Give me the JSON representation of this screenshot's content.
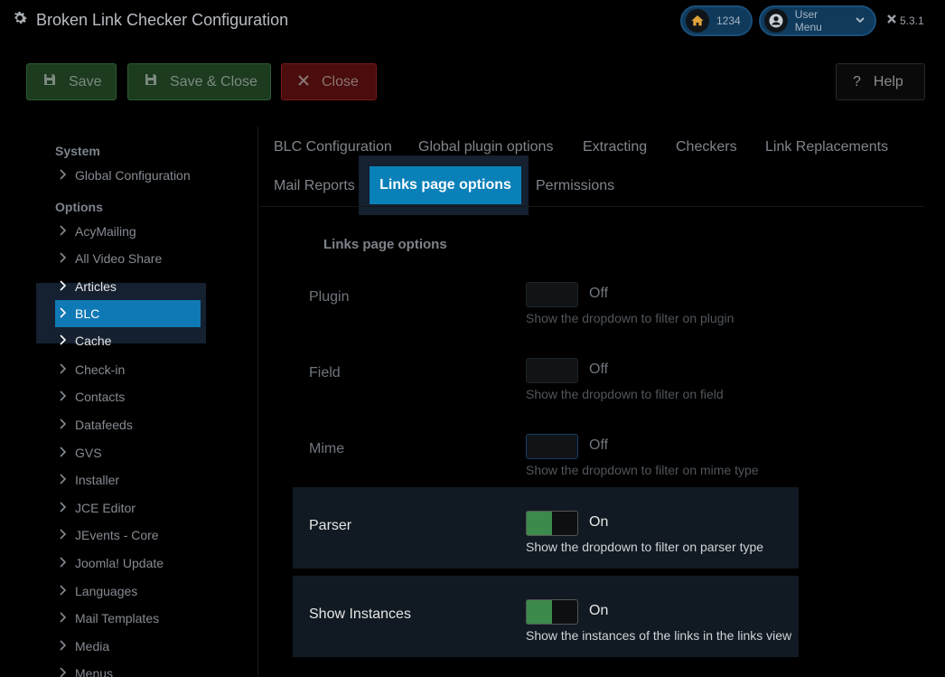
{
  "header": {
    "title": "Broken Link Checker Configuration",
    "home_count": "1234",
    "user_menu_label": "User Menu",
    "version": "5.3.1"
  },
  "toolbar": {
    "save_label": "Save",
    "save_close_label": "Save & Close",
    "close_label": "Close",
    "help_label": "Help"
  },
  "sidebar": {
    "system_heading": "System",
    "global_config": "Global Configuration",
    "options_heading": "Options",
    "items": [
      "AcyMailing",
      "All Video Share",
      "Articles",
      "BLC",
      "Cache",
      "Check-in",
      "Contacts",
      "Datafeeds",
      "GVS",
      "Installer",
      "JCE Editor",
      "JEvents - Core",
      "Joomla! Update",
      "Languages",
      "Mail Templates",
      "Media",
      "Menus"
    ],
    "active_item": "BLC"
  },
  "tabs": {
    "row1": [
      "BLC Configuration",
      "Global plugin options",
      "Extracting",
      "Checkers",
      "Link Replacements"
    ],
    "row2": [
      "Mail Reports",
      "Links page options",
      "Permissions"
    ],
    "active": "Links page options"
  },
  "section": {
    "legend": "Links page options",
    "options": [
      {
        "label": "Plugin",
        "state": "Off",
        "on": false,
        "desc": "Show the dropdown to filter on plugin"
      },
      {
        "label": "Field",
        "state": "Off",
        "on": false,
        "desc": "Show the dropdown to filter on field"
      },
      {
        "label": "Mime",
        "state": "Off",
        "on": false,
        "desc": "Show the dropdown to filter on mime type"
      },
      {
        "label": "Parser",
        "state": "On",
        "on": true,
        "desc": "Show the dropdown to filter on parser type"
      },
      {
        "label": "Show Instances",
        "state": "On",
        "on": true,
        "desc": "Show the instances of the links in the links view"
      }
    ]
  },
  "colors": {
    "accent": "#0a80b8",
    "toggle_on": "#3d8a4d",
    "save_bg": "#1c3b1f",
    "close_bg": "#4a0c0c"
  }
}
